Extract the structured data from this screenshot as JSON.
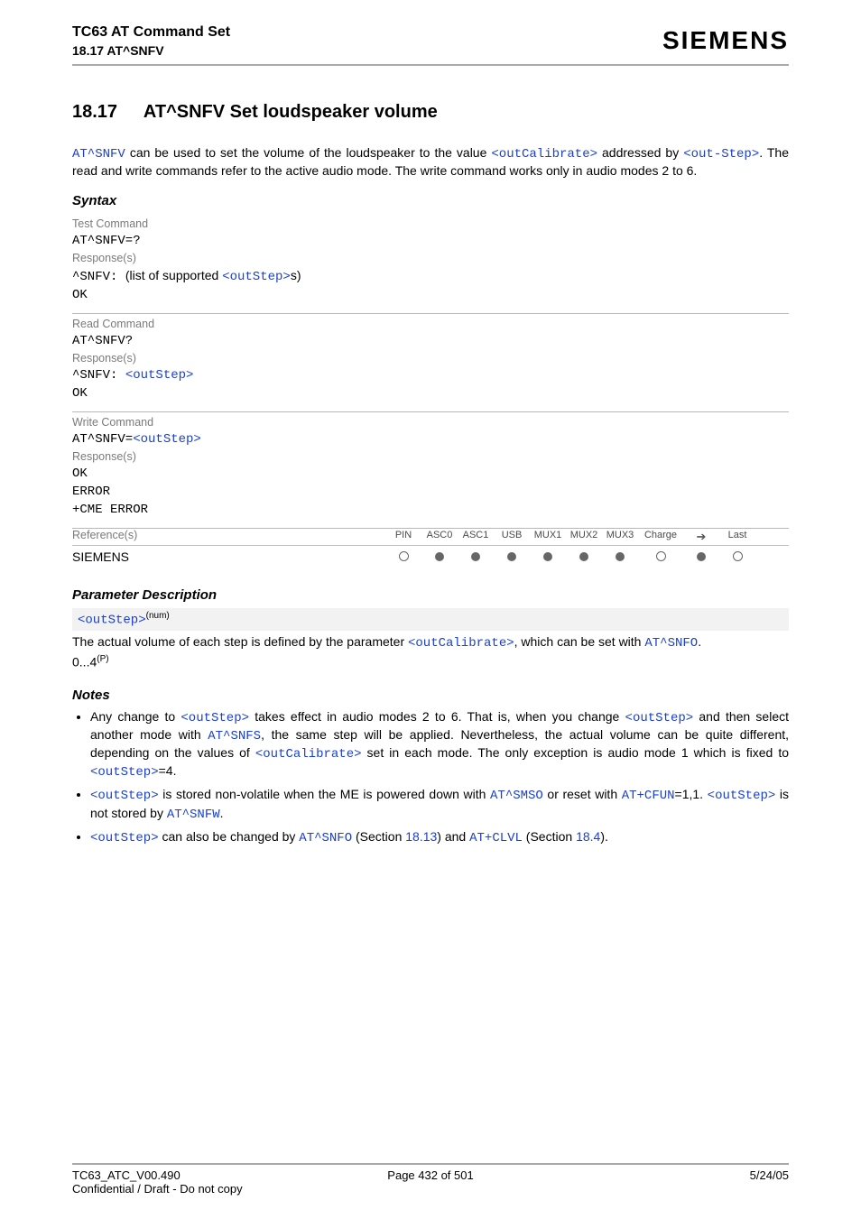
{
  "header": {
    "title": "TC63 AT Command Set",
    "sub": "18.17 AT^SNFV",
    "brand": "SIEMENS"
  },
  "section": {
    "number": "18.17",
    "title": "AT^SNFV   Set loudspeaker volume"
  },
  "intro": {
    "cmd1": "AT^SNFV",
    "t1": " can be used to set the volume of the loudspeaker to the value ",
    "p1": "<outCalibrate>",
    "t2": " addressed by ",
    "p2": "<out-Step>",
    "t3": ". The read and write commands refer to the active audio mode. The write command works only in audio modes 2 to 6."
  },
  "syntax": {
    "heading": "Syntax",
    "test": {
      "label": "Test Command",
      "cmd": "AT^SNFV=?",
      "resp_label": "Response(s)",
      "resp_prefix": "^SNFV: ",
      "resp_mid": "(list of supported ",
      "resp_param": "<outStep>",
      "resp_end": "s)",
      "ok": "OK"
    },
    "read": {
      "label": "Read Command",
      "cmd": "AT^SNFV?",
      "resp_label": "Response(s)",
      "resp_prefix": "^SNFV: ",
      "resp_param": "<outStep>",
      "ok": "OK"
    },
    "write": {
      "label": "Write Command",
      "cmd_prefix": "AT^SNFV=",
      "cmd_param": "<outStep>",
      "resp_label": "Response(s)",
      "ok": "OK",
      "err": "ERROR",
      "cme": "+CME ERROR"
    },
    "ref": {
      "label": "Reference(s)",
      "vendor": "SIEMENS",
      "cols": [
        "PIN",
        "ASC0",
        "ASC1",
        "USB",
        "MUX1",
        "MUX2",
        "MUX3",
        "Charge",
        "➔",
        "Last"
      ],
      "dots": [
        "empty",
        "filled",
        "filled",
        "filled",
        "filled",
        "filled",
        "filled",
        "empty",
        "filled",
        "empty"
      ]
    }
  },
  "param": {
    "heading": "Parameter Description",
    "name": "<outStep>",
    "sup": "(num)",
    "line_a": "The actual volume of each step is defined by the parameter ",
    "line_p": "<outCalibrate>",
    "line_b": ", which can be set with ",
    "line_cmd": "AT^SNFO",
    "line_c": ".",
    "range": "0...4",
    "range_sup": "(P)"
  },
  "notes": {
    "heading": "Notes",
    "n1": {
      "a": "Any change to ",
      "p1": "<outStep>",
      "b": " takes effect in audio modes 2 to 6. That is, when you change ",
      "p2": "<outStep>",
      "c": " and then select another mode with ",
      "cmd": "AT^SNFS",
      "d": ", the same step will be applied. Nevertheless, the actual volume can be quite different, depending on the values of ",
      "p3": "<outCalibrate>",
      "e": " set in each mode. The only exception is audio mode 1 which is fixed to ",
      "p4": "<outStep>",
      "f": "=4."
    },
    "n2": {
      "p1": "<outStep>",
      "a": " is stored non-volatile when the ME is powered down with ",
      "cmd1": "AT^SMSO",
      "b": " or reset with ",
      "cmd2": "AT+CFUN",
      "c": "=1,1. ",
      "p2": "<outStep>",
      "d": " is not stored by ",
      "cmd3": "AT^SNFW",
      "e": "."
    },
    "n3": {
      "p1": "<outStep>",
      "a": " can also be changed by ",
      "cmd1": "AT^SNFO",
      "b": " (Section ",
      "sec1": "18.13",
      "c": ") and ",
      "cmd2": "AT+CLVL",
      "d": " (Section ",
      "sec2": "18.4",
      "e": ")."
    }
  },
  "footer": {
    "left": "TC63_ATC_V00.490",
    "mid": "Page 432 of 501",
    "right": "5/24/05",
    "conf": "Confidential / Draft - Do not copy"
  }
}
